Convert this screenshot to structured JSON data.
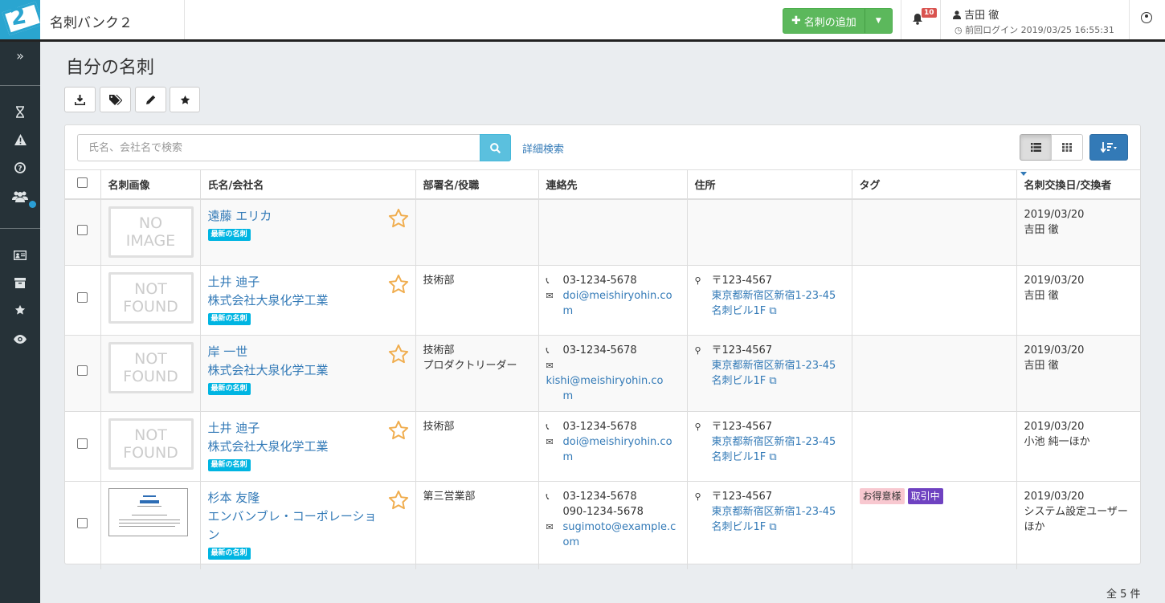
{
  "app": {
    "title": "名刺バンク２",
    "logo_text": "2"
  },
  "header": {
    "add_button": "名刺の追加",
    "notification_count": "10",
    "user_name": "吉田 徹",
    "last_login": "前回ログイン 2019/03/25 16:55:31"
  },
  "page": {
    "title": "自分の名刺"
  },
  "search": {
    "placeholder": "氏名、会社名で検索",
    "advanced_link": "詳細検索"
  },
  "table": {
    "headers": [
      "名刺画像",
      "氏名/会社名",
      "部署名/役職",
      "連絡先",
      "住所",
      "タグ",
      "名刺交換日/交換者"
    ],
    "rows": [
      {
        "image": [
          "NO",
          "IMAGE"
        ],
        "name": "遠藤 エリカ",
        "company": "",
        "badge": "最新の名刺",
        "dept": "",
        "title": "",
        "phone": "",
        "phone2": "",
        "email": "",
        "email2": "",
        "zip": "",
        "addr1": "",
        "addr2": "",
        "tags": [],
        "date": "2019/03/20",
        "exchanger": "吉田 徹"
      },
      {
        "image": [
          "NOT",
          "FOUND"
        ],
        "name": "土井 迪子",
        "company": "株式会社大泉化学工業",
        "badge": "最新の名刺",
        "dept": "技術部",
        "title": "",
        "phone": "03-1234-5678",
        "phone2": "",
        "email": "doi@meishiryohin.co",
        "email2": "m",
        "zip": "〒123-4567",
        "addr1": "東京都新宿区新宿1-23-45",
        "addr2": "名刺ビル1F",
        "tags": [],
        "date": "2019/03/20",
        "exchanger": "吉田 徹"
      },
      {
        "image": [
          "NOT",
          "FOUND"
        ],
        "name": "岸 一世",
        "company": "株式会社大泉化学工業",
        "badge": "最新の名刺",
        "dept": "技術部",
        "title": "プロダクトリーダー",
        "phone": "03-1234-5678",
        "phone2": "",
        "email": "kishi@meishiryohin.co",
        "email2": "m",
        "zip": "〒123-4567",
        "addr1": "東京都新宿区新宿1-23-45",
        "addr2": "名刺ビル1F",
        "tags": [],
        "date": "2019/03/20",
        "exchanger": "吉田 徹"
      },
      {
        "image": [
          "NOT",
          "FOUND"
        ],
        "name": "土井 迪子",
        "company": "株式会社大泉化学工業",
        "badge": "最新の名刺",
        "dept": "技術部",
        "title": "",
        "phone": "03-1234-5678",
        "phone2": "",
        "email": "doi@meishiryohin.co",
        "email2": "m",
        "zip": "〒123-4567",
        "addr1": "東京都新宿区新宿1-23-45",
        "addr2": "名刺ビル1F",
        "tags": [],
        "date": "2019/03/20",
        "exchanger": "小池 純一ほか"
      },
      {
        "image": [
          "CARD"
        ],
        "name": "杉本 友隆",
        "company": "エンバンブレ・コーポレーション",
        "badge": "最新の名刺",
        "dept": "第三営業部",
        "title": "",
        "phone": "03-1234-5678",
        "phone2": "090-1234-5678",
        "email": "sugimoto@example.c",
        "email2": "om",
        "zip": "〒123-4567",
        "addr1": "東京都新宿区新宿1-23-45",
        "addr2": "名刺ビル1F",
        "tags": [
          {
            "label": "お得意様",
            "bg": "#f8c8d0",
            "fg": "#333"
          },
          {
            "label": "取引中",
            "bg": "#6f42c1",
            "fg": "#ffffff"
          }
        ],
        "date": "2019/03/20",
        "exchanger": "システム設定ユーザーほか"
      }
    ]
  },
  "footer": {
    "total": "全 5 件"
  },
  "colors": {
    "accent": "#337ab7",
    "success": "#5cb85c",
    "info": "#5bc0de",
    "sidebar": "#263238",
    "star": "#f0ad4e",
    "badge": "#00b5e2"
  },
  "icons": {
    "sidebar": [
      "double-chevron-right-icon",
      "hourglass-icon",
      "warning-icon",
      "question-icon",
      "users-icon",
      "id-card-icon",
      "archive-icon",
      "star-icon",
      "eye-icon"
    ],
    "toolbar": [
      "download-icon",
      "tags-icon",
      "pencil-icon",
      "star-icon"
    ]
  }
}
